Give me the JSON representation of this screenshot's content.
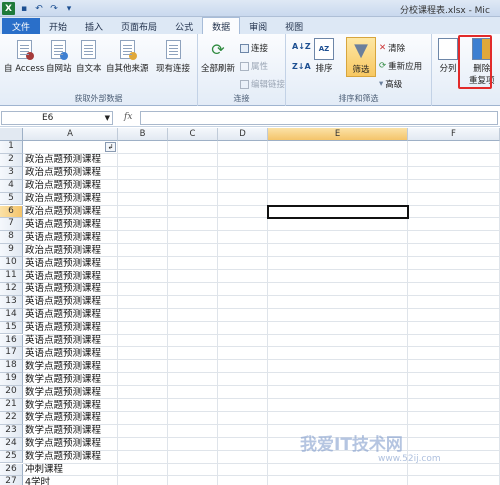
{
  "window": {
    "title": "分校课程表.xlsx - Mic"
  },
  "tabs": [
    "文件",
    "开始",
    "插入",
    "页面布局",
    "公式",
    "数据",
    "审阅",
    "视图"
  ],
  "ribbon": {
    "get_external": {
      "label": "获取外部数据",
      "access": "自 Access",
      "web": "自网站",
      "text": "自文本",
      "other": "自其他来源",
      "existing": "现有连接"
    },
    "connections": {
      "label": "连接",
      "refresh_all": "全部刷新",
      "connections": "连接",
      "properties": "属性",
      "edit_links": "编辑链接"
    },
    "sort_filter": {
      "label": "排序和筛选",
      "sort": "排序",
      "filter": "筛选",
      "clear": "清除",
      "reapply": "重新应用",
      "advanced": "高级"
    },
    "data_tools": {
      "split": "分列",
      "remove_dup_line1": "删除",
      "remove_dup_line2": "重复项"
    }
  },
  "formula_bar": {
    "name_box": "E6",
    "fx": "fx",
    "value": ""
  },
  "columns": [
    "A",
    "B",
    "C",
    "D",
    "E",
    "F"
  ],
  "selected_cell": "E6",
  "rows": [
    "",
    "政治点题预测课程",
    "政治点题预测课程",
    "政治点题预测课程",
    "政治点题预测课程",
    "政治点题预测课程",
    "英语点题预测课程",
    "英语点题预测课程",
    "政治点题预测课程",
    "英语点题预测课程",
    "英语点题预测课程",
    "英语点题预测课程",
    "英语点题预测课程",
    "英语点题预测课程",
    "英语点题预测课程",
    "英语点题预测课程",
    "英语点题预测课程",
    "数学点题预测课程",
    "数学点题预测课程",
    "数学点题预测课程",
    "数学点题预测课程",
    "数学点题预测课程",
    "数学点题预测课程",
    "数学点题预测课程",
    "数学点题预测课程",
    "冲刺课程",
    "4学时"
  ],
  "watermark": {
    "text": "我爱IT技术网",
    "url": "www.52ij.com"
  },
  "colors": {
    "file_tab": "#2a6fc9",
    "highlight": "#e22a2a",
    "selected_header": "#f4c46a"
  }
}
